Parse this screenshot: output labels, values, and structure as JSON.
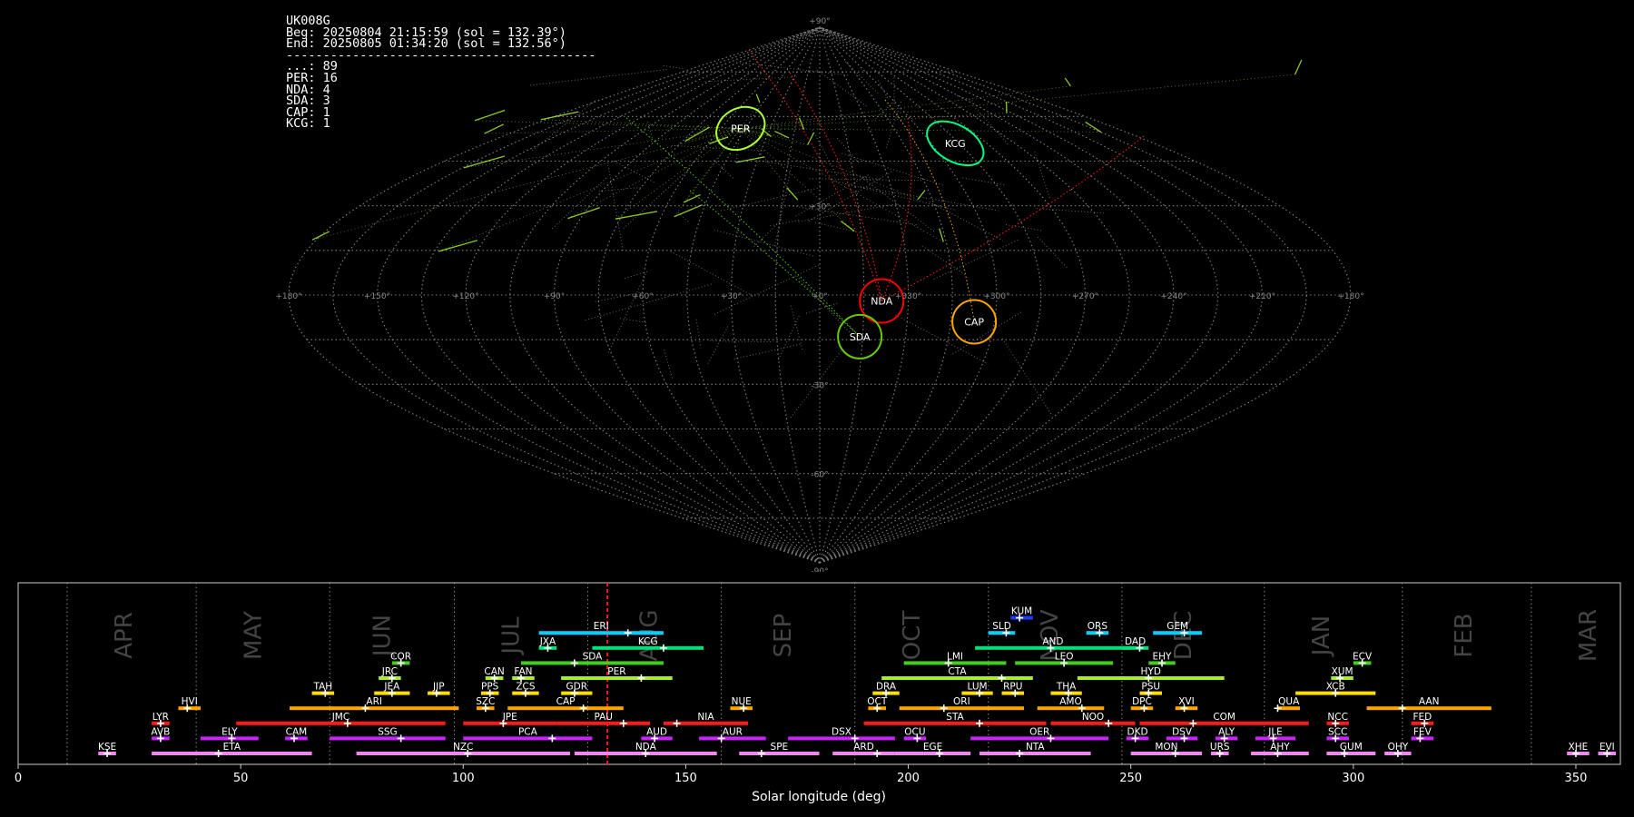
{
  "info": {
    "station": "UK008G",
    "begin": "Beg: 20250804 21:15:59 (sol = 132.39°)",
    "end": "End: 20250805 01:34:20 (sol = 132.56°)",
    "separator": "------------------------------------------",
    "counts": [
      {
        "label": "...",
        "value": 89
      },
      {
        "label": "PER",
        "value": 16
      },
      {
        "label": "NDA",
        "value": 4
      },
      {
        "label": "SDA",
        "value": 3
      },
      {
        "label": "CAP",
        "value": 1
      },
      {
        "label": "KCG",
        "value": 1
      }
    ]
  },
  "sky_map": {
    "projection": "sinusoidal",
    "lat_labels": [
      "+90°",
      "+30°",
      "+0°",
      "-30°",
      "-60°",
      "-90°"
    ],
    "lon_labels": [
      "+180°",
      "+150°",
      "+120°",
      "+90°",
      "+60°",
      "+30°",
      "+0°",
      "+330°",
      "+300°",
      "+270°",
      "+240°",
      "+210°",
      "+180°"
    ],
    "radiants": [
      {
        "code": "PER",
        "lon": 48,
        "lat": 56,
        "color": "#adff2f"
      },
      {
        "code": "KCG",
        "lon": 287,
        "lat": 51,
        "color": "#00ff7f"
      },
      {
        "code": "NDA",
        "lon": 339,
        "lat": -2,
        "color": "#ff0000"
      },
      {
        "code": "CAP",
        "lon": 307,
        "lat": -9,
        "color": "#ffa500"
      },
      {
        "code": "SDA",
        "lon": 346,
        "lat": -14,
        "color": "#66cc00"
      }
    ],
    "colors": {
      "grid": "#808080",
      "sporadic": "#bbbbbb"
    }
  },
  "chart_data": {
    "type": "timeline",
    "xlabel": "Solar longitude (deg)",
    "xlim": [
      0,
      360
    ],
    "xticks": [
      0,
      50,
      100,
      150,
      200,
      250,
      300,
      350
    ],
    "current_sol": 132.4,
    "months": [
      {
        "name": "APR",
        "start": 11,
        "center": 24
      },
      {
        "name": "MAY",
        "start": 40,
        "center": 53
      },
      {
        "name": "JUN",
        "start": 70,
        "center": 82
      },
      {
        "name": "JUL",
        "start": 98,
        "center": 111
      },
      {
        "name": "AUG",
        "start": 128,
        "center": 142
      },
      {
        "name": "SEP",
        "start": 158,
        "center": 172
      },
      {
        "name": "OCT",
        "start": 188,
        "center": 201
      },
      {
        "name": "NOV",
        "start": 218,
        "center": 232
      },
      {
        "name": "DEC",
        "start": 248,
        "center": 262
      },
      {
        "name": "JAN",
        "start": 280,
        "center": 293
      },
      {
        "name": "FEB",
        "start": 311,
        "center": 325
      },
      {
        "name": "MAR",
        "start": 340,
        "center": 353
      }
    ],
    "showers": [
      {
        "code": "KUM",
        "start": 223,
        "end": 228,
        "peak": 225,
        "row": 9,
        "color": "#1e3cff"
      },
      {
        "code": "ERI",
        "start": 117,
        "end": 145,
        "peak": 137,
        "row": 8,
        "color": "#00d0ff"
      },
      {
        "code": "SLD",
        "start": 218,
        "end": 224,
        "peak": 222,
        "row": 8,
        "color": "#00d0ff"
      },
      {
        "code": "ORS",
        "start": 240,
        "end": 245,
        "peak": 243,
        "row": 8,
        "color": "#00d0ff"
      },
      {
        "code": "GEM",
        "start": 255,
        "end": 266,
        "peak": 262,
        "row": 8,
        "color": "#00d0ff"
      },
      {
        "code": "JXA",
        "start": 117,
        "end": 121,
        "peak": 119,
        "row": 7,
        "color": "#00e07a"
      },
      {
        "code": "KCG",
        "start": 129,
        "end": 154,
        "peak": 145,
        "row": 7,
        "color": "#00e07a"
      },
      {
        "code": "AND",
        "start": 215,
        "end": 250,
        "peak": 232,
        "row": 7,
        "color": "#00e07a"
      },
      {
        "code": "DAD",
        "start": 248,
        "end": 254,
        "peak": 252,
        "row": 7,
        "color": "#00e07a"
      },
      {
        "code": "COR",
        "start": 84,
        "end": 88,
        "peak": 86,
        "row": 6,
        "color": "#44cc22"
      },
      {
        "code": "SDA",
        "start": 113,
        "end": 145,
        "peak": 125,
        "row": 6,
        "color": "#44cc22"
      },
      {
        "code": "LMI",
        "start": 199,
        "end": 222,
        "peak": 209,
        "row": 6,
        "color": "#44cc22"
      },
      {
        "code": "LEO",
        "start": 224,
        "end": 246,
        "peak": 235,
        "row": 6,
        "color": "#44cc22"
      },
      {
        "code": "EHY",
        "start": 254,
        "end": 260,
        "peak": 257,
        "row": 6,
        "color": "#44cc22"
      },
      {
        "code": "ECV",
        "start": 300,
        "end": 304,
        "peak": 302,
        "row": 6,
        "color": "#44cc22"
      },
      {
        "code": "JRC",
        "start": 81,
        "end": 86,
        "peak": 84,
        "row": 5,
        "color": "#aaee22"
      },
      {
        "code": "CAN",
        "start": 105,
        "end": 109,
        "peak": 107,
        "row": 5,
        "color": "#aaee22"
      },
      {
        "code": "FAN",
        "start": 111,
        "end": 116,
        "peak": 113,
        "row": 5,
        "color": "#aaee22"
      },
      {
        "code": "PER",
        "start": 122,
        "end": 147,
        "peak": 140,
        "row": 5,
        "color": "#aaee22"
      },
      {
        "code": "CTA",
        "start": 194,
        "end": 228,
        "peak": 221,
        "row": 5,
        "color": "#aaee22"
      },
      {
        "code": "HYD",
        "start": 238,
        "end": 271,
        "peak": 254,
        "row": 5,
        "color": "#aaee22"
      },
      {
        "code": "XUM",
        "start": 295,
        "end": 300,
        "peak": 297,
        "row": 5,
        "color": "#aaee22"
      },
      {
        "code": "TAH",
        "start": 66,
        "end": 71,
        "peak": 69,
        "row": 4,
        "color": "#ffdd00"
      },
      {
        "code": "JEA",
        "start": 80,
        "end": 88,
        "peak": 84,
        "row": 4,
        "color": "#ffdd00"
      },
      {
        "code": "JIP",
        "start": 92,
        "end": 97,
        "peak": 94,
        "row": 4,
        "color": "#ffdd00"
      },
      {
        "code": "PPS",
        "start": 104,
        "end": 108,
        "peak": 106,
        "row": 4,
        "color": "#ffdd00"
      },
      {
        "code": "ZCS",
        "start": 111,
        "end": 117,
        "peak": 114,
        "row": 4,
        "color": "#ffdd00"
      },
      {
        "code": "GDR",
        "start": 122,
        "end": 129,
        "peak": 125,
        "row": 4,
        "color": "#ffdd00"
      },
      {
        "code": "DRA",
        "start": 192,
        "end": 198,
        "peak": 195,
        "row": 4,
        "color": "#ffdd00"
      },
      {
        "code": "LUM",
        "start": 212,
        "end": 219,
        "peak": 216,
        "row": 4,
        "color": "#ffdd00"
      },
      {
        "code": "RPU",
        "start": 221,
        "end": 226,
        "peak": 224,
        "row": 4,
        "color": "#ffdd00"
      },
      {
        "code": "THA",
        "start": 232,
        "end": 239,
        "peak": 236,
        "row": 4,
        "color": "#ffdd00"
      },
      {
        "code": "PSU",
        "start": 252,
        "end": 257,
        "peak": 254,
        "row": 4,
        "color": "#ffdd00"
      },
      {
        "code": "XCB",
        "start": 287,
        "end": 305,
        "peak": 296,
        "row": 4,
        "color": "#ffdd00"
      },
      {
        "code": "HVI",
        "start": 36,
        "end": 41,
        "peak": 38,
        "row": 3,
        "color": "#ffa500"
      },
      {
        "code": "ARI",
        "start": 61,
        "end": 99,
        "peak": 78,
        "row": 3,
        "color": "#ffa500"
      },
      {
        "code": "SZC",
        "start": 103,
        "end": 107,
        "peak": 105,
        "row": 3,
        "color": "#ffa500"
      },
      {
        "code": "CAP",
        "start": 110,
        "end": 136,
        "peak": 127,
        "row": 3,
        "color": "#ffa500"
      },
      {
        "code": "NUE",
        "start": 160,
        "end": 165,
        "peak": 163,
        "row": 3,
        "color": "#ffa500"
      },
      {
        "code": "OCT",
        "start": 191,
        "end": 195,
        "peak": 193,
        "row": 3,
        "color": "#ffa500"
      },
      {
        "code": "ORI",
        "start": 198,
        "end": 226,
        "peak": 208,
        "row": 3,
        "color": "#ffa500"
      },
      {
        "code": "AMO",
        "start": 229,
        "end": 244,
        "peak": 239,
        "row": 3,
        "color": "#ffa500"
      },
      {
        "code": "DPC",
        "start": 250,
        "end": 255,
        "peak": 253,
        "row": 3,
        "color": "#ffa500"
      },
      {
        "code": "XVI",
        "start": 260,
        "end": 265,
        "peak": 262,
        "row": 3,
        "color": "#ffa500"
      },
      {
        "code": "QUA",
        "start": 283,
        "end": 288,
        "peak": 283,
        "row": 3,
        "color": "#ffa500"
      },
      {
        "code": "AAN",
        "start": 303,
        "end": 331,
        "peak": 311,
        "row": 3,
        "color": "#ffa500"
      },
      {
        "code": "LYR",
        "start": 30,
        "end": 34,
        "peak": 32,
        "row": 2,
        "color": "#ff1a1a"
      },
      {
        "code": "JMC",
        "start": 49,
        "end": 96,
        "peak": 74,
        "row": 2,
        "color": "#ff1a1a"
      },
      {
        "code": "JPE",
        "start": 100,
        "end": 121,
        "peak": 109,
        "row": 2,
        "color": "#ff1a1a"
      },
      {
        "code": "PAU",
        "start": 121,
        "end": 142,
        "peak": 136,
        "row": 2,
        "color": "#ff1a1a"
      },
      {
        "code": "NIA",
        "start": 145,
        "end": 164,
        "peak": 148,
        "row": 2,
        "color": "#ff1a1a"
      },
      {
        "code": "STA",
        "start": 190,
        "end": 231,
        "peak": 216,
        "row": 2,
        "color": "#ff1a1a"
      },
      {
        "code": "NOO",
        "start": 232,
        "end": 251,
        "peak": 245,
        "row": 2,
        "color": "#ff1a1a"
      },
      {
        "code": "COM",
        "start": 252,
        "end": 290,
        "peak": 264,
        "row": 2,
        "color": "#ff1a1a"
      },
      {
        "code": "NCC",
        "start": 294,
        "end": 299,
        "peak": 296,
        "row": 2,
        "color": "#ff1a1a"
      },
      {
        "code": "FED",
        "start": 313,
        "end": 318,
        "peak": 316,
        "row": 2,
        "color": "#ff1a1a"
      },
      {
        "code": "AVB",
        "start": 30,
        "end": 34,
        "peak": 32,
        "row": 1,
        "color": "#cc22ff"
      },
      {
        "code": "ELY",
        "start": 41,
        "end": 54,
        "peak": 48,
        "row": 1,
        "color": "#cc22ff"
      },
      {
        "code": "CAM",
        "start": 60,
        "end": 65,
        "peak": 62,
        "row": 1,
        "color": "#cc22ff"
      },
      {
        "code": "SSG",
        "start": 70,
        "end": 96,
        "peak": 86,
        "row": 1,
        "color": "#cc22ff"
      },
      {
        "code": "PCA",
        "start": 100,
        "end": 129,
        "peak": 120,
        "row": 1,
        "color": "#cc22ff"
      },
      {
        "code": "AUD",
        "start": 140,
        "end": 147,
        "peak": 143,
        "row": 1,
        "color": "#cc22ff"
      },
      {
        "code": "AUR",
        "start": 153,
        "end": 168,
        "peak": 158,
        "row": 1,
        "color": "#cc22ff"
      },
      {
        "code": "DSX",
        "start": 173,
        "end": 197,
        "peak": 188,
        "row": 1,
        "color": "#cc22ff"
      },
      {
        "code": "OCU",
        "start": 199,
        "end": 204,
        "peak": 202,
        "row": 1,
        "color": "#cc22ff"
      },
      {
        "code": "OER",
        "start": 214,
        "end": 245,
        "peak": 232,
        "row": 1,
        "color": "#cc22ff"
      },
      {
        "code": "DKD",
        "start": 249,
        "end": 254,
        "peak": 251,
        "row": 1,
        "color": "#cc22ff"
      },
      {
        "code": "DSV",
        "start": 258,
        "end": 265,
        "peak": 262,
        "row": 1,
        "color": "#cc22ff"
      },
      {
        "code": "ALY",
        "start": 269,
        "end": 274,
        "peak": 271,
        "row": 1,
        "color": "#cc22ff"
      },
      {
        "code": "JLE",
        "start": 278,
        "end": 287,
        "peak": 282,
        "row": 1,
        "color": "#cc22ff"
      },
      {
        "code": "SCC",
        "start": 294,
        "end": 299,
        "peak": 296,
        "row": 1,
        "color": "#cc22ff"
      },
      {
        "code": "FEV",
        "start": 313,
        "end": 318,
        "peak": 315,
        "row": 1,
        "color": "#cc22ff"
      },
      {
        "code": "KSE",
        "start": 18,
        "end": 22,
        "peak": 20,
        "row": 0,
        "color": "#ee88ee"
      },
      {
        "code": "ETA",
        "start": 30,
        "end": 66,
        "peak": 45,
        "row": 0,
        "color": "#ee88ee"
      },
      {
        "code": "NZC",
        "start": 76,
        "end": 124,
        "peak": 101,
        "row": 0,
        "color": "#ee88ee"
      },
      {
        "code": "NDA",
        "start": 125,
        "end": 157,
        "peak": 141,
        "row": 0,
        "color": "#ee88ee"
      },
      {
        "code": "SPE",
        "start": 162,
        "end": 180,
        "peak": 167,
        "row": 0,
        "color": "#ee88ee"
      },
      {
        "code": "ARD",
        "start": 183,
        "end": 197,
        "peak": 193,
        "row": 0,
        "color": "#ee88ee"
      },
      {
        "code": "EGE",
        "start": 197,
        "end": 214,
        "peak": 207,
        "row": 0,
        "color": "#ee88ee"
      },
      {
        "code": "NTA",
        "start": 216,
        "end": 241,
        "peak": 225,
        "row": 0,
        "color": "#ee88ee"
      },
      {
        "code": "MON",
        "start": 250,
        "end": 266,
        "peak": 260,
        "row": 0,
        "color": "#ee88ee"
      },
      {
        "code": "URS",
        "start": 268,
        "end": 272,
        "peak": 270,
        "row": 0,
        "color": "#ee88ee"
      },
      {
        "code": "AHY",
        "start": 277,
        "end": 290,
        "peak": 283,
        "row": 0,
        "color": "#ee88ee"
      },
      {
        "code": "GUM",
        "start": 294,
        "end": 305,
        "peak": 298,
        "row": 0,
        "color": "#ee88ee"
      },
      {
        "code": "OHY",
        "start": 307,
        "end": 313,
        "peak": 310,
        "row": 0,
        "color": "#ee88ee"
      },
      {
        "code": "XHE",
        "start": 348,
        "end": 353,
        "peak": 350,
        "row": 0,
        "color": "#ee88ee"
      },
      {
        "code": "EVI",
        "start": 355,
        "end": 359,
        "peak": 357,
        "row": 0,
        "color": "#ee88ee"
      }
    ]
  }
}
